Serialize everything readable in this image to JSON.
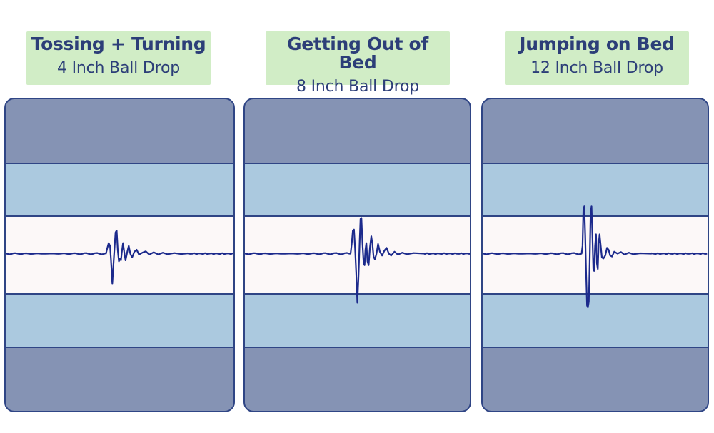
{
  "panels": [
    {
      "title": "Tossing + Turning",
      "subtitle": "4 Inch Ball Drop",
      "waveform": {
        "onset_fraction": 0.44,
        "samples": [
          [
            0.44,
            0
          ],
          [
            0.445,
            0.25
          ],
          [
            0.452,
            0.55
          ],
          [
            0.458,
            0.4
          ],
          [
            0.462,
            -0.3
          ],
          [
            0.468,
            -1.55
          ],
          [
            0.475,
            -0.2
          ],
          [
            0.482,
            1.1
          ],
          [
            0.487,
            1.2
          ],
          [
            0.492,
            0.2
          ],
          [
            0.497,
            -0.4
          ],
          [
            0.502,
            -0.25
          ],
          [
            0.506,
            -0.35
          ],
          [
            0.51,
            0.1
          ],
          [
            0.515,
            0.55
          ],
          [
            0.52,
            0.1
          ],
          [
            0.526,
            -0.35
          ],
          [
            0.534,
            0.1
          ],
          [
            0.54,
            0.4
          ],
          [
            0.547,
            0.0
          ],
          [
            0.555,
            -0.2
          ],
          [
            0.565,
            0.1
          ],
          [
            0.575,
            0.2
          ],
          [
            0.585,
            -0.05
          ],
          [
            0.6,
            0.05
          ],
          [
            0.615,
            0.12
          ],
          [
            0.63,
            -0.05
          ],
          [
            0.65,
            0.07
          ],
          [
            0.67,
            -0.04
          ],
          [
            0.69,
            0.05
          ],
          [
            0.71,
            -0.03
          ],
          [
            0.74,
            0.03
          ],
          [
            0.77,
            -0.02
          ],
          [
            0.8,
            0.01
          ],
          [
            1.0,
            0
          ]
        ]
      }
    },
    {
      "title": "Getting Out of Bed",
      "subtitle": "8 Inch Ball Drop",
      "waveform": {
        "onset_fraction": 0.47,
        "samples": [
          [
            0.47,
            0
          ],
          [
            0.475,
            0.5
          ],
          [
            0.48,
            1.2
          ],
          [
            0.485,
            1.25
          ],
          [
            0.49,
            0.3
          ],
          [
            0.495,
            -1.0
          ],
          [
            0.5,
            -2.55
          ],
          [
            0.505,
            -1.2
          ],
          [
            0.51,
            0.6
          ],
          [
            0.514,
            1.8
          ],
          [
            0.518,
            1.85
          ],
          [
            0.523,
            0.5
          ],
          [
            0.528,
            -0.5
          ],
          [
            0.532,
            -0.6
          ],
          [
            0.536,
            0.2
          ],
          [
            0.54,
            0.55
          ],
          [
            0.545,
            -0.4
          ],
          [
            0.55,
            -0.6
          ],
          [
            0.556,
            0.3
          ],
          [
            0.562,
            0.9
          ],
          [
            0.567,
            0.5
          ],
          [
            0.572,
            -0.15
          ],
          [
            0.578,
            -0.3
          ],
          [
            0.585,
            0.0
          ],
          [
            0.592,
            0.5
          ],
          [
            0.6,
            0.1
          ],
          [
            0.61,
            -0.1
          ],
          [
            0.62,
            0.15
          ],
          [
            0.63,
            0.3
          ],
          [
            0.64,
            0.0
          ],
          [
            0.65,
            -0.1
          ],
          [
            0.665,
            0.1
          ],
          [
            0.68,
            -0.05
          ],
          [
            0.7,
            0.05
          ],
          [
            0.72,
            -0.03
          ],
          [
            0.75,
            0.03
          ],
          [
            0.8,
            0.0
          ],
          [
            1.0,
            0
          ]
        ]
      }
    },
    {
      "title": "Jumping on Bed",
      "subtitle": "12 Inch Ball Drop",
      "waveform": {
        "onset_fraction": 0.44,
        "samples": [
          [
            0.44,
            0
          ],
          [
            0.444,
            0.4
          ],
          [
            0.448,
            2.3
          ],
          [
            0.452,
            2.45
          ],
          [
            0.456,
            1.0
          ],
          [
            0.46,
            -1.0
          ],
          [
            0.464,
            -2.7
          ],
          [
            0.468,
            -2.8
          ],
          [
            0.472,
            -2.5
          ],
          [
            0.476,
            -0.5
          ],
          [
            0.48,
            2.1
          ],
          [
            0.484,
            2.45
          ],
          [
            0.488,
            1.0
          ],
          [
            0.492,
            -0.8
          ],
          [
            0.496,
            -0.9
          ],
          [
            0.5,
            0.4
          ],
          [
            0.504,
            1.0
          ],
          [
            0.508,
            -0.5
          ],
          [
            0.512,
            -0.8
          ],
          [
            0.516,
            0.5
          ],
          [
            0.52,
            1.0
          ],
          [
            0.525,
            0.4
          ],
          [
            0.53,
            -0.2
          ],
          [
            0.537,
            -0.25
          ],
          [
            0.545,
            -0.1
          ],
          [
            0.553,
            0.3
          ],
          [
            0.56,
            0.2
          ],
          [
            0.567,
            -0.1
          ],
          [
            0.575,
            -0.15
          ],
          [
            0.585,
            0.1
          ],
          [
            0.6,
            0.0
          ],
          [
            0.615,
            0.08
          ],
          [
            0.63,
            -0.05
          ],
          [
            0.65,
            0.05
          ],
          [
            0.67,
            -0.03
          ],
          [
            0.7,
            0.02
          ],
          [
            0.75,
            0.0
          ],
          [
            1.0,
            0
          ]
        ]
      }
    }
  ],
  "colors": {
    "label_background": "#d1edc6",
    "label_text": "#2c3e78",
    "outer_band": "#8593b4",
    "middle_band": "#abc9df",
    "center_band": "#fcf8f8",
    "border": "#2f4585",
    "waveform": "#1c2a8c"
  }
}
